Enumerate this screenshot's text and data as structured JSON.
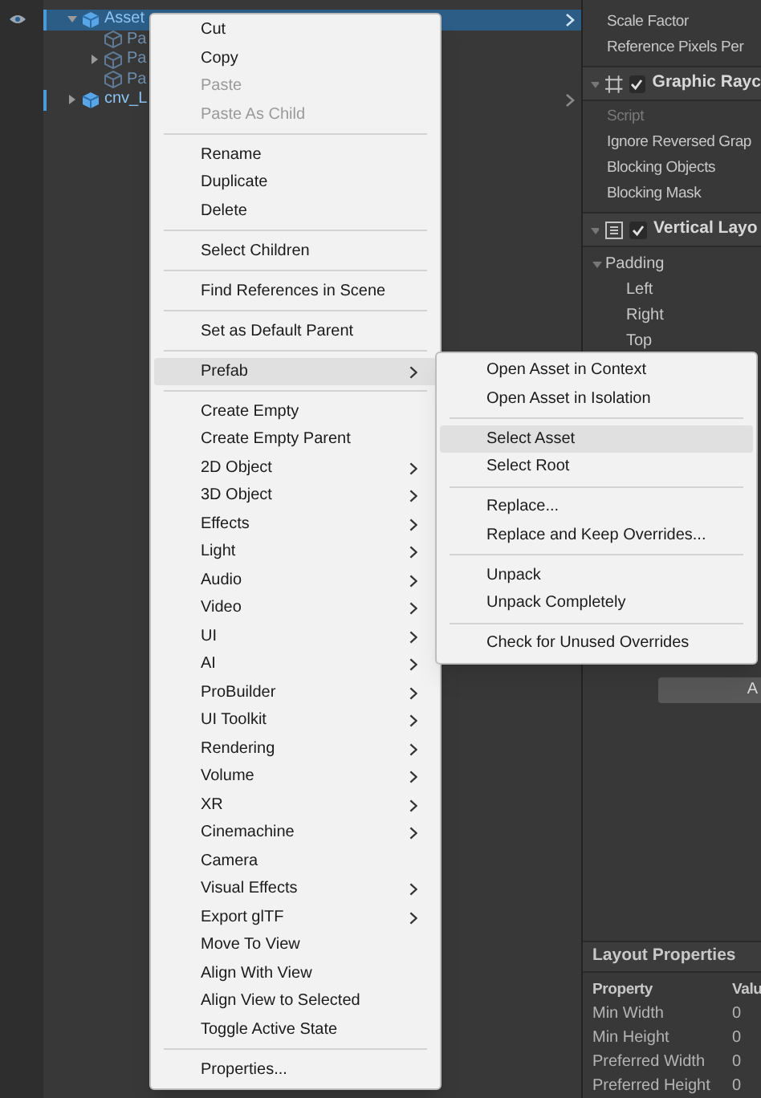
{
  "hierarchy": {
    "rows": [
      {
        "label": "Asset",
        "kind": "prefab",
        "selected": true,
        "expanded": true,
        "children": [
          {
            "label": "Pa",
            "kind": "child",
            "selected": false
          },
          {
            "label": "Pa",
            "kind": "child",
            "selected": false,
            "expanded": false
          },
          {
            "label": "Pa",
            "kind": "child",
            "selected": false
          }
        ]
      },
      {
        "label": "cnv_L",
        "kind": "prefab",
        "selected": false,
        "expanded": false
      }
    ]
  },
  "inspector": {
    "rows": [
      {
        "kind": "field",
        "label": "Scale Factor",
        "disabled": false
      },
      {
        "kind": "field",
        "label": "Reference Pixels Per",
        "disabled": false
      },
      {
        "kind": "header",
        "label": "Graphic Rayc",
        "checked": true
      },
      {
        "kind": "field",
        "label": "Script",
        "disabled": true
      },
      {
        "kind": "field",
        "label": "Ignore Reversed Grap",
        "disabled": false
      },
      {
        "kind": "field",
        "label": "Blocking Objects",
        "disabled": false
      },
      {
        "kind": "field",
        "label": "Blocking Mask",
        "disabled": false
      },
      {
        "kind": "header",
        "label": "Vertical Layo",
        "checked": true
      },
      {
        "kind": "foldout",
        "label": "Padding",
        "expanded": true
      },
      {
        "kind": "subfield",
        "label": "Left"
      },
      {
        "kind": "subfield",
        "label": "Right"
      },
      {
        "kind": "subfield",
        "label": "Top"
      }
    ],
    "button": "A",
    "layout_properties": {
      "title": "Layout Properties",
      "columns": [
        "Property",
        "Valu"
      ],
      "rows": [
        [
          "Min Width",
          "0"
        ],
        [
          "Min Height",
          "0"
        ],
        [
          "Preferred Width",
          "0"
        ],
        [
          "Preferred Height",
          "0"
        ]
      ]
    }
  },
  "context_menu": {
    "groups": [
      [
        {
          "label": "Cut",
          "disabled": false,
          "selected": false,
          "has_submenu": false
        },
        {
          "label": "Copy",
          "disabled": false,
          "selected": false,
          "has_submenu": false
        },
        {
          "label": "Paste",
          "disabled": true,
          "selected": false,
          "has_submenu": false
        },
        {
          "label": "Paste As Child",
          "disabled": true,
          "selected": false,
          "has_submenu": false
        }
      ],
      [
        {
          "label": "Rename",
          "disabled": false,
          "selected": false,
          "has_submenu": false
        },
        {
          "label": "Duplicate",
          "disabled": false,
          "selected": false,
          "has_submenu": false
        },
        {
          "label": "Delete",
          "disabled": false,
          "selected": false,
          "has_submenu": false
        }
      ],
      [
        {
          "label": "Select Children",
          "disabled": false,
          "selected": false,
          "has_submenu": false
        }
      ],
      [
        {
          "label": "Find References in Scene",
          "disabled": false,
          "selected": false,
          "has_submenu": false
        }
      ],
      [
        {
          "label": "Set as Default Parent",
          "disabled": false,
          "selected": false,
          "has_submenu": false
        }
      ],
      [
        {
          "label": "Prefab",
          "disabled": false,
          "selected": true,
          "has_submenu": true
        }
      ],
      [
        {
          "label": "Create Empty",
          "disabled": false,
          "selected": false,
          "has_submenu": false
        },
        {
          "label": "Create Empty Parent",
          "disabled": false,
          "selected": false,
          "has_submenu": false
        },
        {
          "label": "2D Object",
          "disabled": false,
          "selected": false,
          "has_submenu": true
        },
        {
          "label": "3D Object",
          "disabled": false,
          "selected": false,
          "has_submenu": true
        },
        {
          "label": "Effects",
          "disabled": false,
          "selected": false,
          "has_submenu": true
        },
        {
          "label": "Light",
          "disabled": false,
          "selected": false,
          "has_submenu": true
        },
        {
          "label": "Audio",
          "disabled": false,
          "selected": false,
          "has_submenu": true
        },
        {
          "label": "Video",
          "disabled": false,
          "selected": false,
          "has_submenu": true
        },
        {
          "label": "UI",
          "disabled": false,
          "selected": false,
          "has_submenu": true
        },
        {
          "label": "AI",
          "disabled": false,
          "selected": false,
          "has_submenu": true
        },
        {
          "label": "ProBuilder",
          "disabled": false,
          "selected": false,
          "has_submenu": true
        },
        {
          "label": "UI Toolkit",
          "disabled": false,
          "selected": false,
          "has_submenu": true
        },
        {
          "label": "Rendering",
          "disabled": false,
          "selected": false,
          "has_submenu": true
        },
        {
          "label": "Volume",
          "disabled": false,
          "selected": false,
          "has_submenu": true
        },
        {
          "label": "XR",
          "disabled": false,
          "selected": false,
          "has_submenu": true
        },
        {
          "label": "Cinemachine",
          "disabled": false,
          "selected": false,
          "has_submenu": true
        },
        {
          "label": "Camera",
          "disabled": false,
          "selected": false,
          "has_submenu": false
        },
        {
          "label": "Visual Effects",
          "disabled": false,
          "selected": false,
          "has_submenu": true
        },
        {
          "label": "Export glTF",
          "disabled": false,
          "selected": false,
          "has_submenu": true
        },
        {
          "label": "Move To View",
          "disabled": false,
          "selected": false,
          "has_submenu": false
        },
        {
          "label": "Align With View",
          "disabled": false,
          "selected": false,
          "has_submenu": false
        },
        {
          "label": "Align View to Selected",
          "disabled": false,
          "selected": false,
          "has_submenu": false
        },
        {
          "label": "Toggle Active State",
          "disabled": false,
          "selected": false,
          "has_submenu": false
        }
      ],
      [
        {
          "label": "Properties...",
          "disabled": false,
          "selected": false,
          "has_submenu": false
        }
      ]
    ]
  },
  "submenu": {
    "groups": [
      [
        {
          "label": "Open Asset in Context",
          "disabled": false,
          "selected": false,
          "has_submenu": false
        },
        {
          "label": "Open Asset in Isolation",
          "disabled": false,
          "selected": false,
          "has_submenu": false
        }
      ],
      [
        {
          "label": "Select Asset",
          "disabled": false,
          "selected": true,
          "has_submenu": false
        },
        {
          "label": "Select Root",
          "disabled": false,
          "selected": false,
          "has_submenu": false
        }
      ],
      [
        {
          "label": "Replace...",
          "disabled": false,
          "selected": false,
          "has_submenu": false
        },
        {
          "label": "Replace and Keep Overrides...",
          "disabled": false,
          "selected": false,
          "has_submenu": false
        }
      ],
      [
        {
          "label": "Unpack",
          "disabled": false,
          "selected": false,
          "has_submenu": false
        },
        {
          "label": "Unpack Completely",
          "disabled": false,
          "selected": false,
          "has_submenu": false
        }
      ],
      [
        {
          "label": "Check for Unused Overrides",
          "disabled": false,
          "selected": false,
          "has_submenu": false
        }
      ]
    ]
  }
}
